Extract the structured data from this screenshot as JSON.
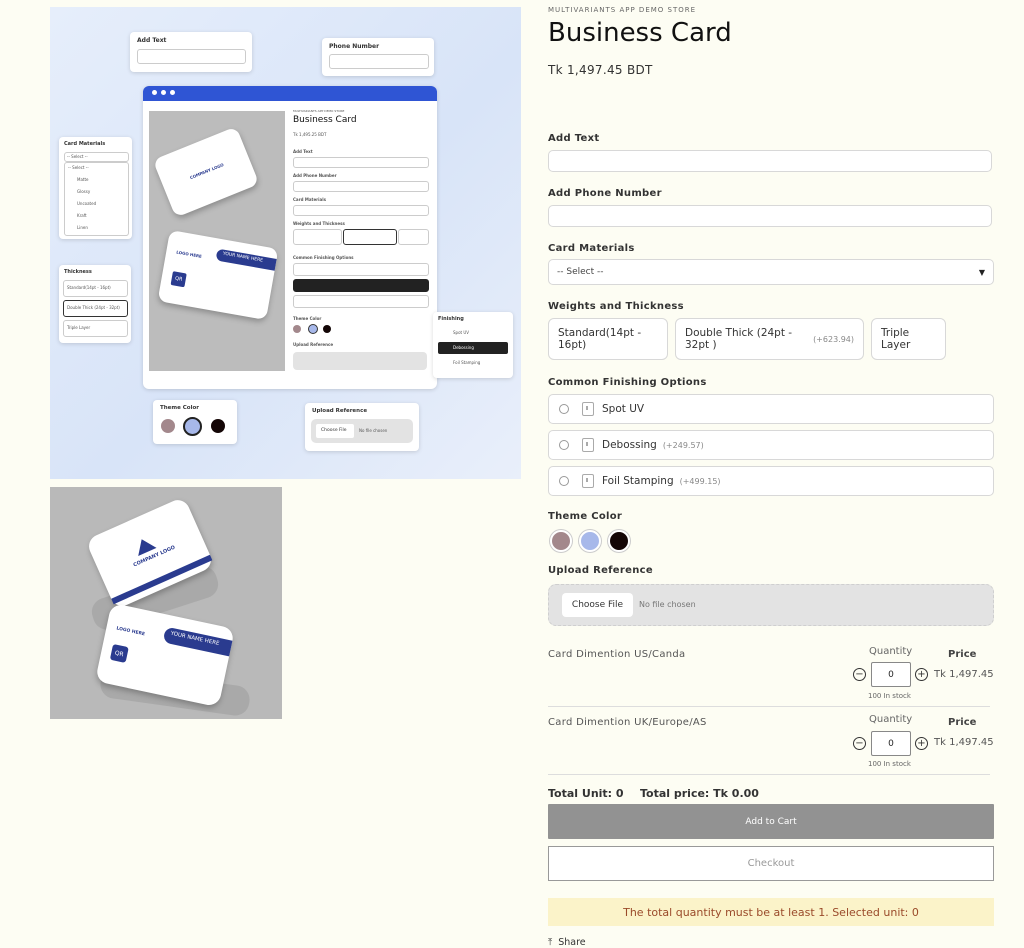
{
  "gallery": {
    "mock": {
      "add_text_label": "Add Text",
      "phone_label": "Phone Number",
      "card_materials_label": "Card Materials",
      "select_placeholder": "-- Select --",
      "materials": [
        "Matte",
        "Glossy",
        "Uncoated",
        "Kraft",
        "Linen"
      ],
      "thickness_label": "Thickness",
      "thickness_options": [
        "Standard(14pt - 16pt)",
        "Double Thick (24pt - 32pt)",
        "Triple Layer"
      ],
      "theme_color_label": "Theme Color",
      "upload_label": "Upload Reference",
      "choose_file": "Choose File",
      "no_file": "No file chosen",
      "finishing_label": "Finishing",
      "finishing_options": [
        "Spot UV",
        "Debossing",
        "Foil Stamping"
      ],
      "inner_vendor": "MULTIVARIANTS APP DEMO STORE",
      "inner_title": "Business Card",
      "inner_price": "Tk 1,495.25 BDT",
      "inner_add_text": "Add Text",
      "inner_phone": "Add Phone Number",
      "inner_materials": "Card Materials",
      "inner_weights": "Weights and Thickness",
      "inner_finishing": "Common Finishing Options",
      "inner_theme": "Theme Color",
      "inner_upload": "Upload Reference",
      "card_company": "COMPANY LOGO",
      "card_logo_here": "LOGO HERE",
      "card_your_name": "YOUR NAME HERE",
      "card_qr": "QR"
    }
  },
  "product": {
    "vendor": "MULTIVARIANTS APP DEMO STORE",
    "title": "Business Card",
    "price": "Tk 1,497.45 BDT"
  },
  "form": {
    "add_text_label": "Add Text",
    "add_text_value": "",
    "phone_label": "Add Phone Number",
    "phone_value": "",
    "materials_label": "Card Materials",
    "materials_selected": "-- Select --",
    "weights_label": "Weights and Thickness",
    "weights": [
      {
        "label": "Standard(14pt - 16pt)",
        "add": ""
      },
      {
        "label": "Double Thick (24pt - 32pt )",
        "add": "(+623.94)"
      },
      {
        "label": "Triple Layer",
        "add": ""
      }
    ],
    "finishing_label": "Common Finishing Options",
    "finishing": [
      {
        "label": "Spot UV",
        "add": ""
      },
      {
        "label": "Debossing",
        "add": "(+249.57)"
      },
      {
        "label": "Foil Stamping",
        "add": "(+499.15)"
      }
    ],
    "theme_color_label": "Theme Color",
    "theme_colors": [
      "#a3888c",
      "#a7b8ea",
      "#140606"
    ],
    "upload_label": "Upload Reference",
    "choose_file": "Choose File",
    "no_file": "No file chosen"
  },
  "dimensions": [
    {
      "label": "Card Dimention US/Canda",
      "quantity_header": "Quantity",
      "price_header": "Price",
      "quantity": "0",
      "price": "Tk 1,497.45",
      "stock": "100 In stock"
    },
    {
      "label": "Card Dimention UK/Europe/AS",
      "quantity_header": "Quantity",
      "price_header": "Price",
      "quantity": "0",
      "price": "Tk 1,497.45",
      "stock": "100 In stock"
    }
  ],
  "totals": {
    "unit": "Total Unit: 0",
    "price": "Total price:  Tk 0.00"
  },
  "actions": {
    "add_to_cart": "Add to Cart",
    "checkout": "Checkout",
    "notice": "The total quantity must be at least 1. Selected unit: 0",
    "share": "Share"
  },
  "colors": {
    "brand_blue": "#2a3b8f",
    "hero_window_bar": "#2f55d4",
    "notice_bg": "#fbf3c9",
    "button_gray": "#929292"
  }
}
